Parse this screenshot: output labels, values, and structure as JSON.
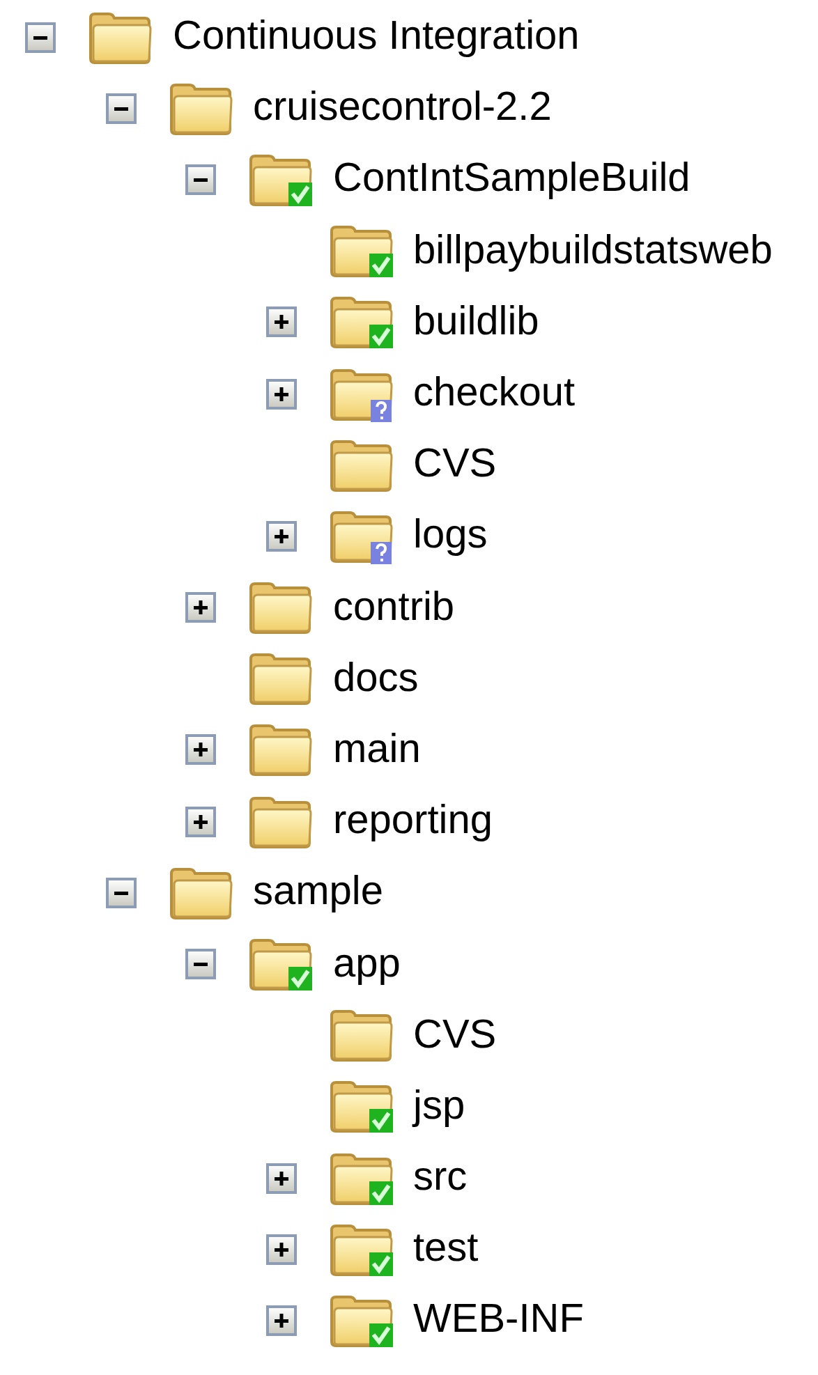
{
  "tree": [
    {
      "label": "Continuous Integration",
      "expanded": true,
      "children": [
        {
          "label": "cruisecontrol-2.2",
          "expanded": true,
          "children": [
            {
              "label": "ContIntSampleBuild",
              "expanded": true,
              "synced": true,
              "children": [
                {
                  "label": "billpaybuildstatsweb",
                  "synced": true
                },
                {
                  "label": "buildlib",
                  "expanded": false,
                  "synced": true
                },
                {
                  "label": "checkout",
                  "expanded": false,
                  "synced": false
                },
                {
                  "label": "CVS"
                },
                {
                  "label": "logs",
                  "expanded": false,
                  "synced": false
                }
              ]
            },
            {
              "label": "contrib",
              "expanded": false
            },
            {
              "label": "docs"
            },
            {
              "label": "main",
              "expanded": false
            },
            {
              "label": "reporting",
              "expanded": false
            }
          ]
        },
        {
          "label": "sample",
          "expanded": true,
          "children": [
            {
              "label": "app",
              "expanded": true,
              "synced": true,
              "children": [
                {
                  "label": "CVS"
                },
                {
                  "label": "jsp",
                  "synced": true
                },
                {
                  "label": "src",
                  "expanded": false,
                  "synced": true
                },
                {
                  "label": "test",
                  "expanded": false,
                  "synced": true
                },
                {
                  "label": "WEB-INF",
                  "expanded": false,
                  "synced": true
                }
              ]
            }
          ]
        }
      ]
    }
  ]
}
